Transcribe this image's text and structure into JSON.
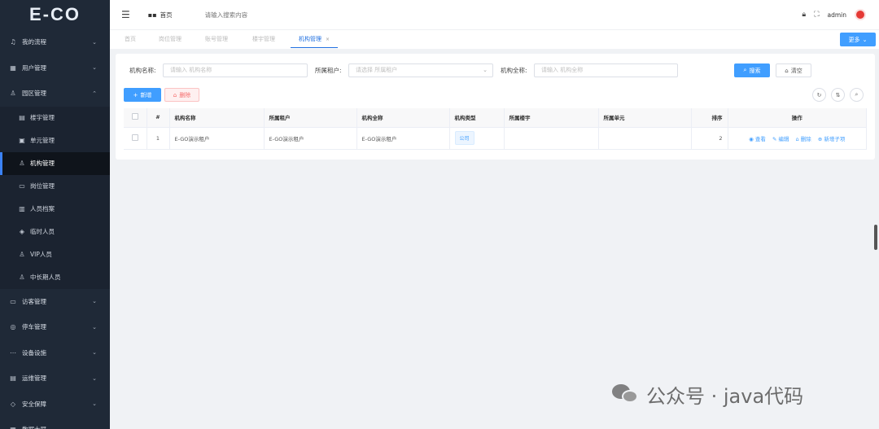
{
  "app": {
    "logo": "E-CO"
  },
  "sidebar": {
    "items": [
      {
        "label": "我的流程",
        "icon": "bell-icon",
        "glyph": "♫",
        "arrow": "⌄"
      },
      {
        "label": "用户管理",
        "icon": "grid-icon",
        "glyph": "▦",
        "arrow": "⌄"
      },
      {
        "label": "园区管理",
        "icon": "user-icon",
        "glyph": "♙",
        "arrow": "⌃"
      }
    ],
    "sub_items": [
      {
        "label": "楼宇管理",
        "icon": "building-icon",
        "glyph": "▤"
      },
      {
        "label": "单元管理",
        "icon": "document-icon",
        "glyph": "▣"
      },
      {
        "label": "机构管理",
        "icon": "org-icon",
        "glyph": "♙"
      },
      {
        "label": "岗位管理",
        "icon": "chat-icon",
        "glyph": "▭"
      },
      {
        "label": "人员档案",
        "icon": "card-icon",
        "glyph": "▥"
      },
      {
        "label": "临时人员",
        "icon": "tag-icon",
        "glyph": "◈"
      },
      {
        "label": "VIP人员",
        "icon": "vip-icon",
        "glyph": "♙"
      },
      {
        "label": "中长期人员",
        "icon": "person-icon",
        "glyph": "♙"
      }
    ],
    "bottom_items": [
      {
        "label": "访客管理",
        "icon": "monitor-icon",
        "glyph": "▭",
        "arrow": "⌄"
      },
      {
        "label": "停车管理",
        "icon": "parking-icon",
        "glyph": "◎",
        "arrow": "⌄"
      },
      {
        "label": "设备设施",
        "icon": "dots-icon",
        "glyph": "⋯",
        "arrow": "⌄"
      },
      {
        "label": "运维管理",
        "icon": "tools-icon",
        "glyph": "▤",
        "arrow": "⌄"
      },
      {
        "label": "安全保障",
        "icon": "shield-icon",
        "glyph": "◇",
        "arrow": "⌄"
      },
      {
        "label": "数据大屏",
        "icon": "screen-icon",
        "glyph": "▦",
        "arrow": "⌄"
      }
    ]
  },
  "header": {
    "breadcrumb": "首页",
    "search_placeholder": "请输入搜索内容",
    "user": "admin"
  },
  "tabs": [
    {
      "label": "首页"
    },
    {
      "label": "岗位管理"
    },
    {
      "label": "账号管理"
    },
    {
      "label": "楼宇管理"
    },
    {
      "label": "机构管理",
      "close": "×"
    }
  ],
  "more_label": "更多",
  "filters": {
    "name_label": "机构名称:",
    "name_placeholder": "请输入 机构名称",
    "tenant_label": "所属租户:",
    "tenant_placeholder": "请选择 所属租户",
    "fullname_label": "机构全称:",
    "fullname_placeholder": "请输入 机构全称",
    "search_label": "搜索",
    "clear_label": "清空"
  },
  "actions": {
    "add_label": "新增",
    "delete_label": "删除"
  },
  "table": {
    "headers": [
      "#",
      "机构名称",
      "所属租户",
      "机构全称",
      "机构类型",
      "所属楼宇",
      "所属单元",
      "排序",
      "操作"
    ],
    "rows": [
      {
        "index": "1",
        "name": "E-GO演示租户",
        "tenant": "E-GO演示租户",
        "fullname": "E-GO演示租户",
        "type": "公司",
        "building": "",
        "unit": "",
        "sort": "2",
        "ops": [
          "查看",
          "编辑",
          "删除",
          "新增子项"
        ]
      }
    ]
  },
  "watermark": {
    "text": "公众号 · java代码"
  }
}
